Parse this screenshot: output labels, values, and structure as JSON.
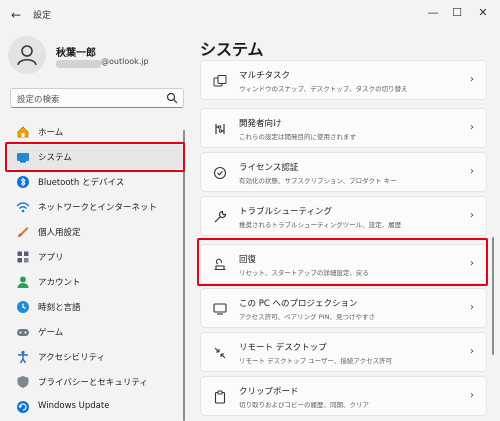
{
  "window": {
    "title": "設定",
    "back_icon": "←",
    "minimize_icon": "—",
    "maximize_icon": "☐",
    "close_icon": "✕"
  },
  "profile": {
    "name": "秋葉一郎",
    "email_suffix": "@outlook.jp"
  },
  "search": {
    "placeholder": "設定の検索"
  },
  "sidebar": {
    "items": [
      {
        "label": "ホーム",
        "icon": "home-icon",
        "active": false
      },
      {
        "label": "システム",
        "icon": "monitor-icon",
        "active": true
      },
      {
        "label": "Bluetooth とデバイス",
        "icon": "bluetooth-icon",
        "active": false
      },
      {
        "label": "ネットワークとインターネット",
        "icon": "wifi-icon",
        "active": false
      },
      {
        "label": "個人用設定",
        "icon": "brush-icon",
        "active": false
      },
      {
        "label": "アプリ",
        "icon": "apps-icon",
        "active": false
      },
      {
        "label": "アカウント",
        "icon": "account-icon",
        "active": false
      },
      {
        "label": "時刻と言語",
        "icon": "globe-clock-icon",
        "active": false
      },
      {
        "label": "ゲーム",
        "icon": "gamepad-icon",
        "active": false
      },
      {
        "label": "アクセシビリティ",
        "icon": "accessibility-icon",
        "active": false
      },
      {
        "label": "プライバシーとセキュリティ",
        "icon": "shield-icon",
        "active": false
      },
      {
        "label": "Windows Update",
        "icon": "update-icon",
        "active": false
      }
    ]
  },
  "main": {
    "title": "システム",
    "cards": [
      {
        "title": "マルチタスク",
        "subtitle": "ウィンドウのスナップ、デスクトップ、タスクの切り替え",
        "icon": "multitask-icon"
      },
      {
        "title": "開発者向け",
        "subtitle": "これらの設定は開発目的に使用されます",
        "icon": "developer-icon"
      },
      {
        "title": "ライセンス認証",
        "subtitle": "有効化の状態、サブスクリプション、プロダクト キー",
        "icon": "activation-icon"
      },
      {
        "title": "トラブルシューティング",
        "subtitle": "推奨されるトラブルシューティングツール、設定、履歴",
        "icon": "wrench-icon"
      },
      {
        "title": "回復",
        "subtitle": "リセット、スタートアップの詳細設定、戻る",
        "icon": "recovery-icon"
      },
      {
        "title": "この PC へのプロジェクション",
        "subtitle": "アクセス許可、ペアリング PIN、見つけやすさ",
        "icon": "projection-icon"
      },
      {
        "title": "リモート デスクトップ",
        "subtitle": "リモート デスクトップ ユーザー、接続アクセス許可",
        "icon": "remote-desktop-icon"
      },
      {
        "title": "クリップボード",
        "subtitle": "切り取りおよびコピーの履歴、同期、クリア",
        "icon": "clipboard-icon"
      }
    ],
    "chevron": "›"
  },
  "colors": {
    "highlight": "#e60012",
    "accent": "#0067c0"
  }
}
